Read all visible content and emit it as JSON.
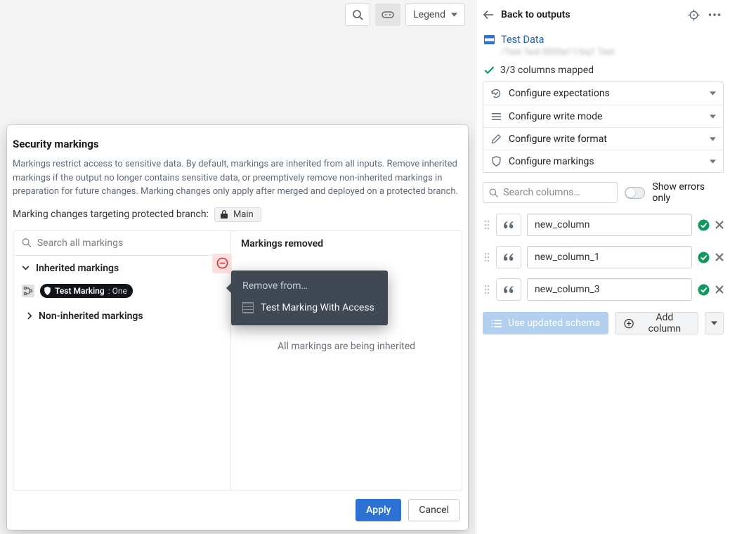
{
  "canvas": {
    "legend_label": "Legend"
  },
  "popover": {
    "title": "Security markings",
    "description": "Markings restrict access to sensitive data. By default, markings are inherited from all inputs. Remove inherited markings if the output no longer contains sensitive data, or preemptively remove non-inherited markings in preparation for future changes. Marking changes only apply after merged and deployed on a protected branch.",
    "branch_label": "Marking changes targeting protected branch:",
    "branch_name": "Main",
    "search_placeholder": "Search all markings",
    "inherited_header": "Inherited markings",
    "noninherited_header": "Non-inherited markings",
    "marking_tag_prefix": "Test Marking",
    "marking_tag_value": ": One",
    "removed_header": "Markings removed",
    "context_menu_title": "Remove from…",
    "context_menu_item": "Test Marking With Access",
    "inherited_message": "All markings are being inherited",
    "apply_label": "Apply",
    "cancel_label": "Cancel"
  },
  "panel": {
    "back_label": "Back to outputs",
    "dataset_name": "Test Data",
    "dataset_path": "/Test Test 0000a11/bq1 Test",
    "mapped_label": "3/3 columns mapped",
    "config": [
      "Configure expectations",
      "Configure write mode",
      "Configure write format",
      "Configure markings"
    ],
    "col_search_placeholder": "Search columns…",
    "errors_label": "Show errors only",
    "columns": [
      "new_column",
      "new_column_1",
      "new_column_3"
    ],
    "updated_schema_label": "Use updated schema",
    "add_column_label": "Add column"
  }
}
